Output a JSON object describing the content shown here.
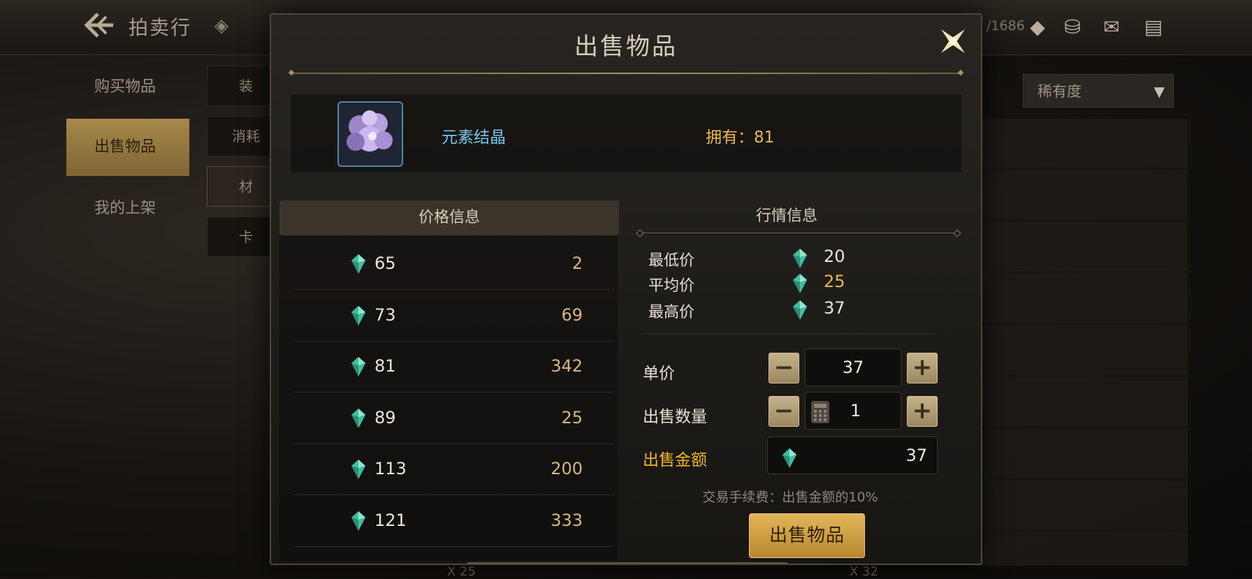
{
  "background": {
    "title": "拍卖行",
    "currency_partial": "/1686",
    "side_tabs": [
      "购买物品",
      "出售物品",
      "我的上架"
    ],
    "active_side_tab": 1,
    "subcats": [
      "装",
      "消耗",
      "材",
      "卡"
    ],
    "rarity_select": "稀有度",
    "bottom_counts": [
      "X 25",
      "X 32"
    ]
  },
  "modal": {
    "title": "出售物品",
    "item": {
      "name": "元素结晶",
      "owned_label": "拥有：81"
    },
    "price_info": {
      "header": "价格信息",
      "rows": [
        {
          "price": "65",
          "qty": "2"
        },
        {
          "price": "73",
          "qty": "69"
        },
        {
          "price": "81",
          "qty": "342"
        },
        {
          "price": "89",
          "qty": "25"
        },
        {
          "price": "113",
          "qty": "200"
        },
        {
          "price": "121",
          "qty": "333"
        }
      ]
    },
    "market": {
      "title": "行情信息",
      "min_label": "最低价",
      "min_value": "20",
      "avg_label": "平均价",
      "avg_value": "25",
      "max_label": "最高价",
      "max_value": "37"
    },
    "form": {
      "unit_price_label": "单价",
      "unit_price": "37",
      "quantity_label": "出售数量",
      "quantity": "1",
      "total_label": "出售金额",
      "total": "37",
      "minus": "−",
      "plus": "+"
    },
    "fee_text": "交易手续费：出售金额的10%",
    "sell_button": "出售物品"
  },
  "colors": {
    "accent_gold": "#e3b55a",
    "item_name": "#77c7e9",
    "gem": "#3fbfa0"
  }
}
